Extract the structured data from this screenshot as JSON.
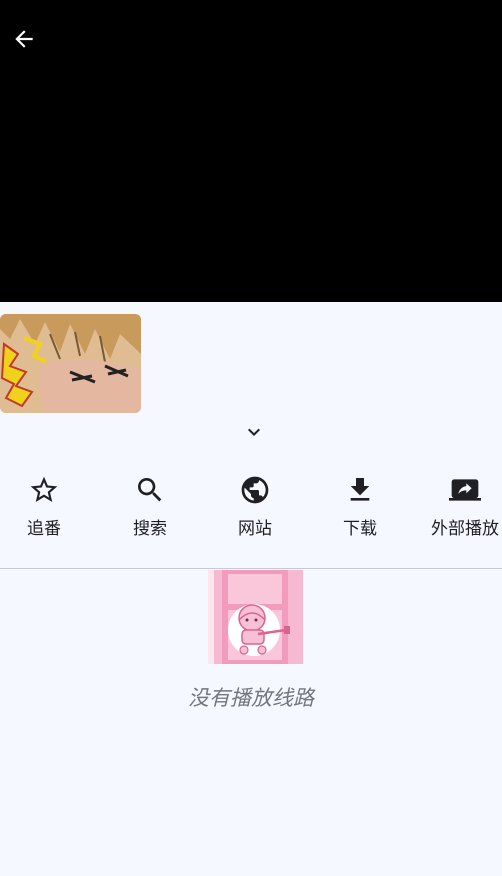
{
  "actions": [
    {
      "label": "追番",
      "icon": "star-outline-icon"
    },
    {
      "label": "搜索",
      "icon": "search-icon"
    },
    {
      "label": "网站",
      "icon": "globe-icon"
    },
    {
      "label": "下载",
      "icon": "download-icon"
    },
    {
      "label": "外部播放",
      "icon": "external-play-icon"
    }
  ],
  "empty_state": {
    "message": "没有播放线路"
  },
  "colors": {
    "background": "#f6f8ff",
    "player": "#000000",
    "text": "#1f1f24",
    "muted_text": "#74767d"
  }
}
